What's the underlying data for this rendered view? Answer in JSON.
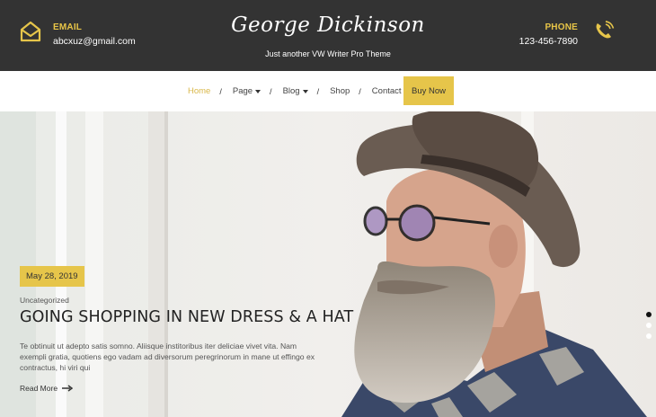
{
  "header": {
    "email_label": "EMAIL",
    "email_value": "abcxuz@gmail.com",
    "site_title": "George Dickinson",
    "tagline": "Just another VW Writer Pro Theme",
    "phone_label": "PHONE",
    "phone_value": "123-456-7890",
    "icons": [
      "envelope-open-icon",
      "phone-ringing-icon"
    ],
    "accent": "#e6c54a",
    "bar_color": "#333333"
  },
  "nav": {
    "items": [
      {
        "label": "Home",
        "active": true
      },
      {
        "label": "Page",
        "dropdown": true
      },
      {
        "label": "Blog",
        "dropdown": true
      },
      {
        "label": "Shop"
      },
      {
        "label": "Contact"
      }
    ],
    "separator": "/",
    "buy_label": "Buy Now"
  },
  "slide": {
    "date": "May 28, 2019",
    "category": "Uncategorized",
    "title": "GOING SHOPPING IN NEW DRESS & A HAT",
    "excerpt": "Te obtinuit ut adepto satis somno. Aliisque institoribus iter deliciae vivet vita. Nam exempli gratia, quotiens ego vadam ad diversorum peregrinorum in mane ut effingo ex contractus, hi viri qui",
    "read_more": "Read More",
    "read_more_icon": "arrow-right-icon",
    "slide_count": 3,
    "active_slide": 1
  }
}
